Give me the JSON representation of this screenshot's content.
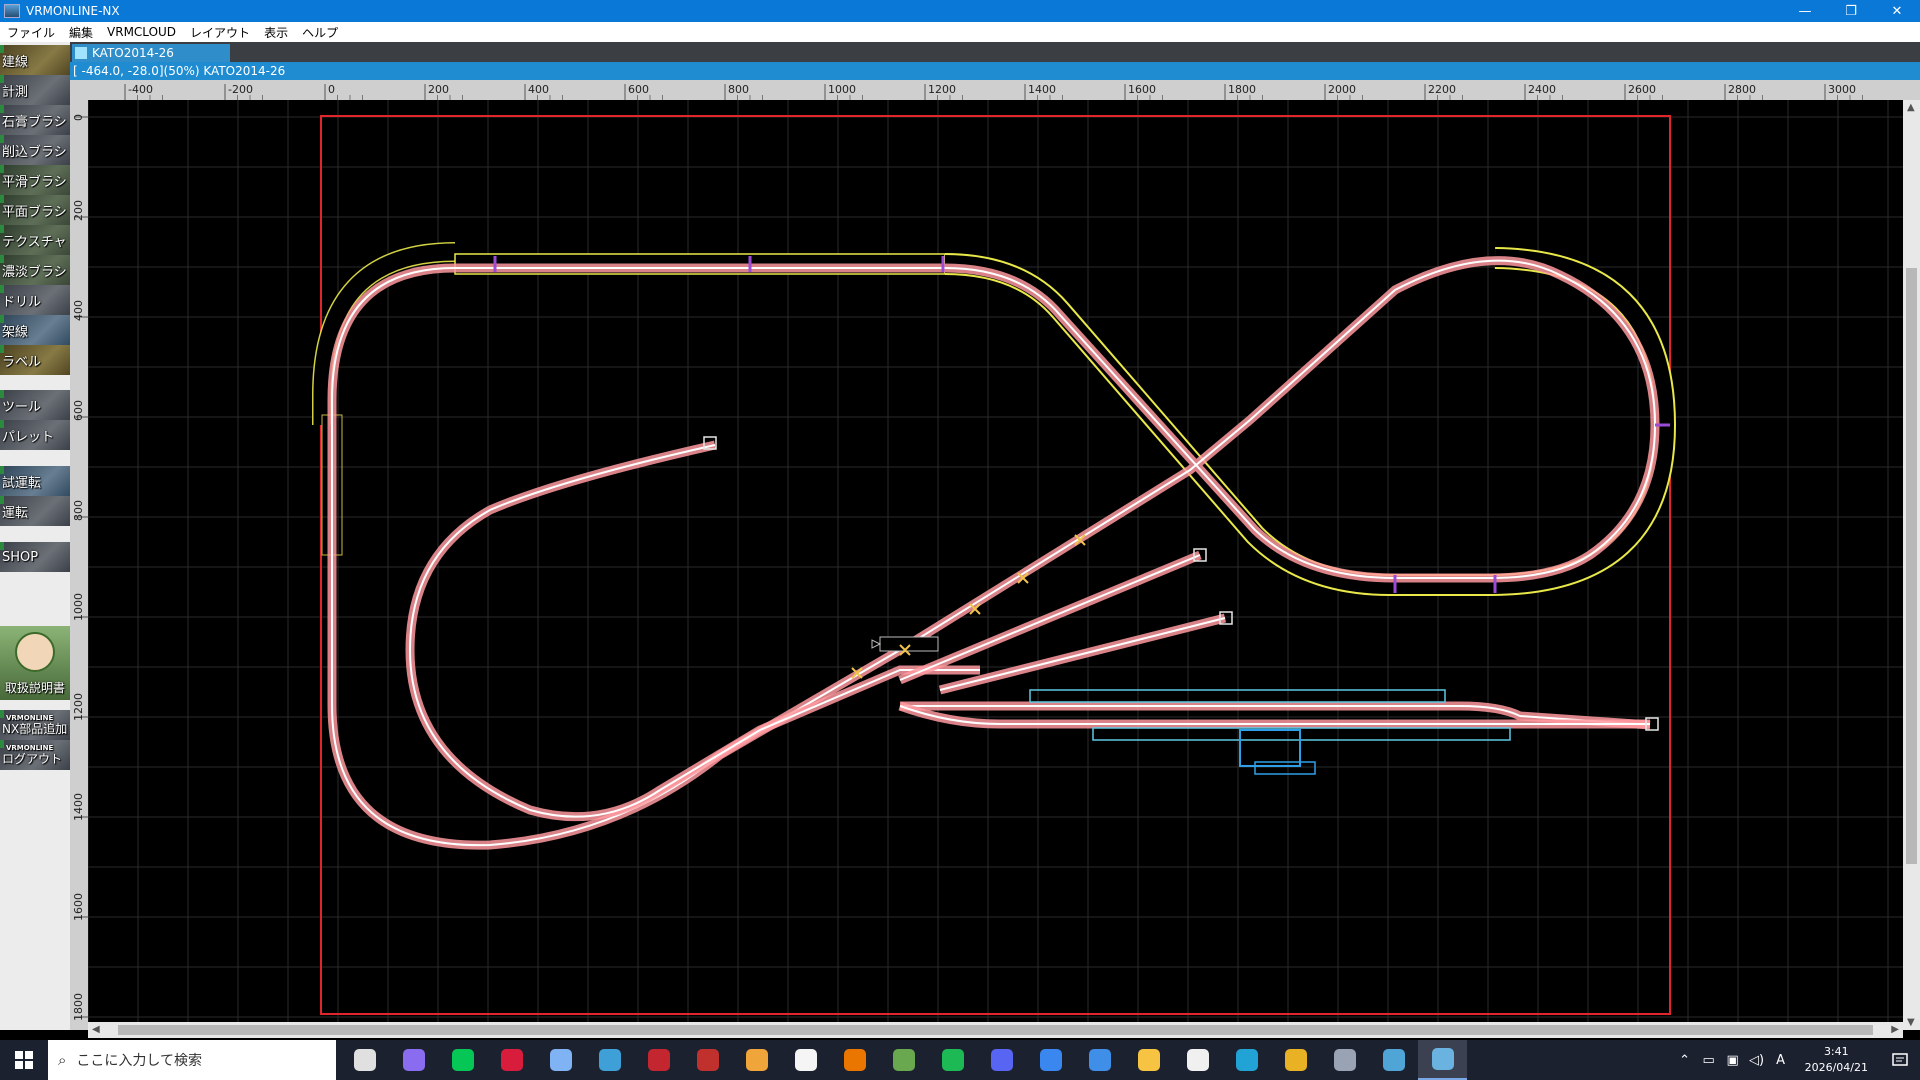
{
  "window": {
    "title": "VRMONLINE-NX",
    "controls": [
      "—",
      "❐",
      "✕"
    ]
  },
  "menu": [
    "ファイル",
    "編集",
    "VRMCLOUD",
    "レイアウト",
    "表示",
    "ヘルプ"
  ],
  "left_tools": [
    {
      "label": "建線",
      "icon": "construct-track-icon"
    },
    {
      "label": "計測",
      "icon": "measure-icon"
    },
    {
      "label": "石膏ブラシ",
      "icon": "plaster-brush-icon"
    },
    {
      "label": "削込ブラシ",
      "icon": "carve-brush-icon"
    },
    {
      "label": "平滑ブラシ",
      "icon": "smooth-brush-icon"
    },
    {
      "label": "平面ブラシ",
      "icon": "flat-brush-icon"
    },
    {
      "label": "テクスチャ",
      "icon": "texture-icon"
    },
    {
      "label": "濃淡ブラシ",
      "icon": "shade-brush-icon"
    },
    {
      "label": "ドリル",
      "icon": "drill-icon"
    },
    {
      "label": "架線",
      "icon": "catenary-icon"
    },
    {
      "label": "ラベル",
      "icon": "label-icon"
    },
    {
      "label": "ツール",
      "icon": "tool-icon"
    },
    {
      "label": "パレット",
      "icon": "palette-icon"
    },
    {
      "label": "試運転",
      "icon": "test-run-icon"
    },
    {
      "label": "運転",
      "icon": "run-icon"
    },
    {
      "label": "SHOP",
      "icon": "shop-icon"
    }
  ],
  "manual": {
    "label": "取扱説明書"
  },
  "nx_add": {
    "brand": "VRMONLINE",
    "label": "NX部品追加"
  },
  "logout": {
    "brand": "VRMONLINE",
    "label": "ログアウト"
  },
  "document": {
    "tab_label": "KATO2014-26",
    "status_text": "[ -464.0,  -28.0](50%) KATO2014-26"
  },
  "hruler_labels": [
    "-400",
    "-200",
    "0",
    "200",
    "400",
    "600",
    "800",
    "1000",
    "1200",
    "1400",
    "1600",
    "1800",
    "2000",
    "2200",
    "2400",
    "2600",
    "2800",
    "3000"
  ],
  "vruler_labels": [
    "0",
    "200",
    "400",
    "600",
    "800",
    "1000",
    "1200",
    "1400",
    "1600",
    "1800"
  ],
  "colors": {
    "boundary": "#e0262a",
    "track": "#ff9aa0",
    "track_rail": "#ffffff",
    "elevated_edge": "#e8e84a",
    "station": "#5ec9e6",
    "grid": "#2a2a2a"
  },
  "taskbar": {
    "search_placeholder": "ここに入力して検索",
    "time": "3:41",
    "date": "2026/04/21",
    "ime": "A",
    "apps": [
      {
        "name": "task-view-icon",
        "color": "#e0e0e0"
      },
      {
        "name": "copilot-icon",
        "color": "#8a6cf0"
      },
      {
        "name": "line-icon",
        "color": "#06c755"
      },
      {
        "name": "red-app-icon",
        "color": "#d81d3c"
      },
      {
        "name": "vivaldi-icon",
        "color": "#7fb3f3"
      },
      {
        "name": "krita-icon",
        "color": "#3fa0d8"
      },
      {
        "name": "target-app-icon",
        "color": "#c3262f"
      },
      {
        "name": "sw-2023-icon",
        "color": "#c0302c"
      },
      {
        "name": "media-icon",
        "color": "#f0a53a"
      },
      {
        "name": "inkscape-icon",
        "color": "#f5f5f5"
      },
      {
        "name": "blender-icon",
        "color": "#ea7600"
      },
      {
        "name": "green-app-icon",
        "color": "#6aa84f"
      },
      {
        "name": "spotify-icon",
        "color": "#1db954"
      },
      {
        "name": "discord-icon",
        "color": "#5865f2"
      },
      {
        "name": "store-icon",
        "color": "#3a87f0"
      },
      {
        "name": "blue-app-icon",
        "color": "#3f8ee8"
      },
      {
        "name": "explorer-icon",
        "color": "#f6c342"
      },
      {
        "name": "solitaire-icon",
        "color": "#f0f0f0"
      },
      {
        "name": "edge-icon",
        "color": "#22a3d6"
      },
      {
        "name": "chrome-icon",
        "color": "#e8b224"
      },
      {
        "name": "camera-icon",
        "color": "#9aa3b3"
      },
      {
        "name": "control-panel-icon",
        "color": "#4fa5d6"
      },
      {
        "name": "vrm-app-icon",
        "color": "#6ab3e0",
        "active": true
      }
    ]
  }
}
